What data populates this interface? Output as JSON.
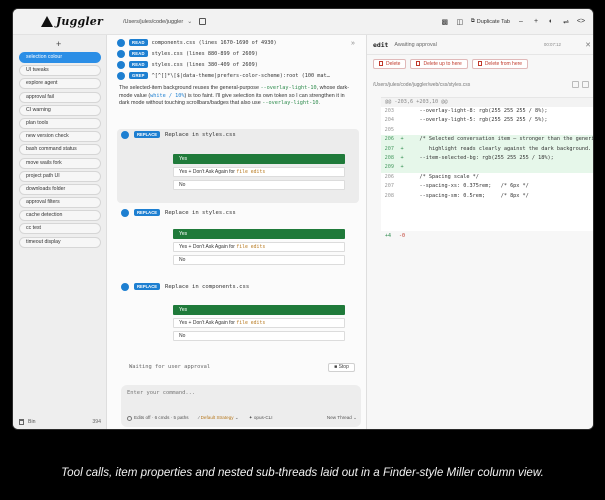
{
  "topbar": {
    "app_name": "Juggler",
    "path": "/Users/jules/code/juggler",
    "duplicate_tab": "Duplicate Tab"
  },
  "sidebar": {
    "items": [
      {
        "label": "selection colour",
        "active": true
      },
      {
        "label": "UI tweaks"
      },
      {
        "label": "explore agent"
      },
      {
        "label": "approval fail"
      },
      {
        "label": "CI warning"
      },
      {
        "label": "plan tools"
      },
      {
        "label": "new version check"
      },
      {
        "label": "bash command status"
      },
      {
        "label": "move wails fork"
      },
      {
        "label": "project path UI"
      },
      {
        "label": "downloads folder"
      },
      {
        "label": "approval filters"
      },
      {
        "label": "cache detection"
      },
      {
        "label": "cc test"
      },
      {
        "label": "timeout display"
      }
    ],
    "bin_label": "Bin",
    "bin_count": "394"
  },
  "thread": {
    "tool_rows": [
      {
        "badge": "READ",
        "text": "components.css (lines 1670-1690 of 4930)"
      },
      {
        "badge": "READ",
        "text": "styles.css (lines 880-899 of 2609)"
      },
      {
        "badge": "READ",
        "text": "styles.css (lines 380-409 of 2609)"
      },
      {
        "badge": "GREP",
        "text": "^[^[]*\\[$|data-theme|prefers-color-scheme):root (100 mat…"
      }
    ],
    "message": {
      "p1": "The selected-item background reuses the general-purpose ",
      "c1": "--overlay-light-10",
      "p2": ", whose dark-mode value (",
      "c2": "white / 10%",
      "p3": ") is too faint. I'll give selection its own token so I can strengthen it in dark mode without touching scrollbars/badges that also use ",
      "c3": "--overlay-light-10",
      "p4": "."
    },
    "approvals": [
      {
        "badge": "REPLACE",
        "title": "Replace in styles.css",
        "yes": "Yes",
        "always_prefix": "Yes + Don't Ask Again for ",
        "always_target": "file edits",
        "no": "No"
      },
      {
        "badge": "REPLACE",
        "title": "Replace in styles.css",
        "yes": "Yes",
        "always_prefix": "Yes + Don't Ask Again for ",
        "always_target": "file edits",
        "no": "No"
      },
      {
        "badge": "REPLACE",
        "title": "Replace in components.css",
        "yes": "Yes",
        "always_prefix": "Yes + Don't Ask Again for ",
        "always_target": "file edits",
        "no": "No"
      }
    ],
    "waiting": "Waiting for user approval",
    "stop_label": "Stop",
    "composer": {
      "placeholder": "Enter your command...",
      "edits": "Edits off · 6 cmds · 5 paths",
      "strategy": "Default Strategy",
      "model": "opus-CLI",
      "new_thread": "New Thread"
    }
  },
  "diff": {
    "title": "edit",
    "status": "Awaiting approval",
    "time": "00:07:12",
    "buttons": [
      "Delete",
      "Delete up to here",
      "Delete from here"
    ],
    "file_path": "/Users/jules/code/juggler/web/css/styles.css",
    "hunk": "@@ -203,6 +203,10 @@",
    "lines": [
      {
        "ln": "203",
        "mk": "",
        "text": "    --overlay-light-8: rgb(255 255 255 / 8%);",
        "add": false
      },
      {
        "ln": "204",
        "mk": "",
        "text": "    --overlay-light-5: rgb(255 255 255 / 5%);",
        "add": false
      },
      {
        "ln": "205",
        "mk": "",
        "text": "",
        "add": false
      },
      {
        "ln": "206",
        "mk": "+",
        "text": "    /* Selected conversation item — stronger than the generic overlay so the",
        "add": true
      },
      {
        "ln": "207",
        "mk": "+",
        "text": "       highlight reads clearly against the dark background. */",
        "add": true
      },
      {
        "ln": "208",
        "mk": "+",
        "text": "    --item-selected-bg: rgb(255 255 255 / 18%);",
        "add": true
      },
      {
        "ln": "209",
        "mk": "+",
        "text": "",
        "add": true
      },
      {
        "ln": "206",
        "mk": "",
        "text": "    /* Spacing scale */",
        "add": false
      },
      {
        "ln": "207",
        "mk": "",
        "text": "    --spacing-xs: 0.375rem;   /* 6px */",
        "add": false
      },
      {
        "ln": "208",
        "mk": "",
        "text": "    --spacing-sm: 0.5rem;     /* 8px */",
        "add": false
      }
    ],
    "added": "+4",
    "removed": "-0"
  },
  "caption": "Tool calls, item properties and nested sub-threads laid out in a Finder-style Miller column view."
}
